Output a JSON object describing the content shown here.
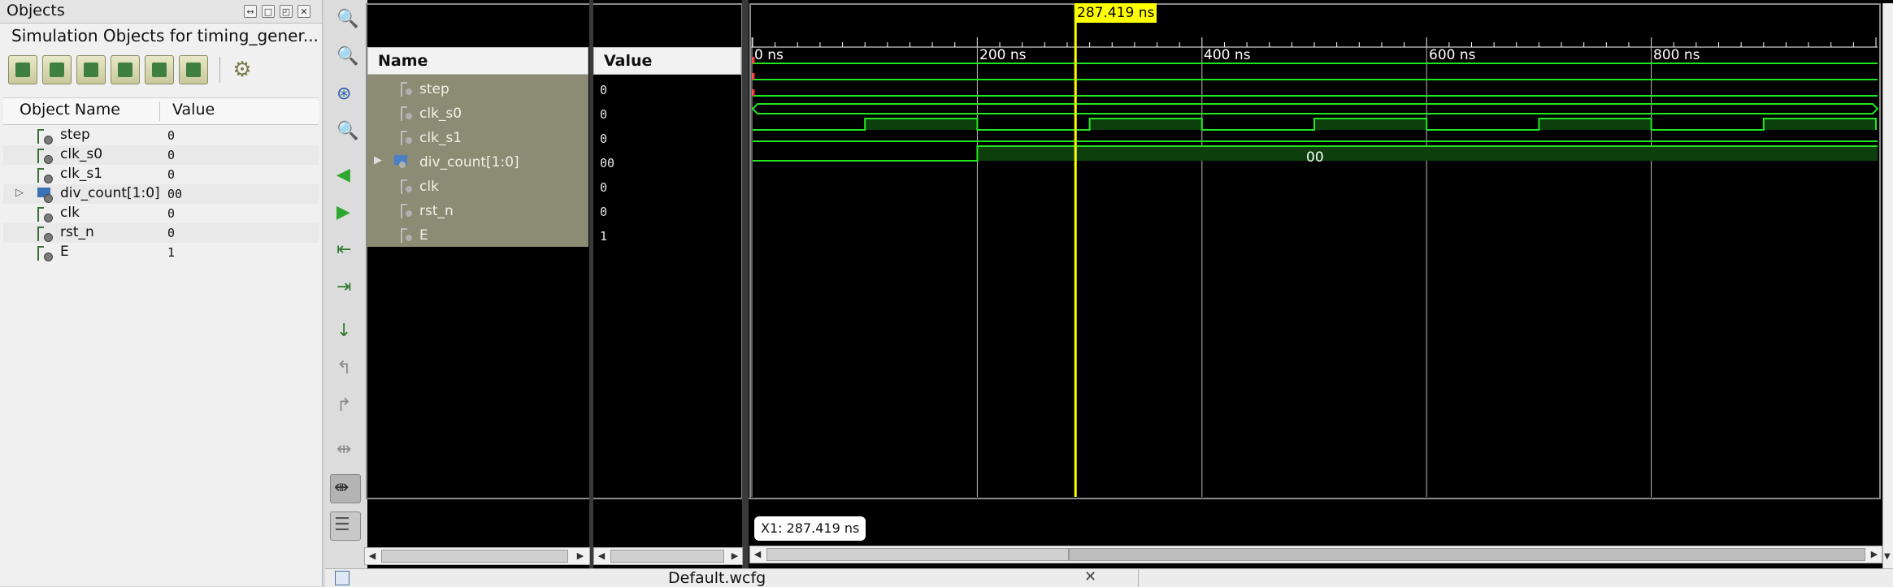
{
  "objects_panel": {
    "title": "Objects",
    "subtitle": "Simulation Objects for timing_gener...",
    "columns": {
      "name": "Object Name",
      "value": "Value"
    },
    "rows": [
      {
        "name": "step",
        "value": "0"
      },
      {
        "name": "clk_s0",
        "value": "0"
      },
      {
        "name": "clk_s1",
        "value": "0"
      },
      {
        "name": "div_count[1:0]",
        "value": "00"
      },
      {
        "name": "clk",
        "value": "0"
      },
      {
        "name": "rst_n",
        "value": "0"
      },
      {
        "name": "E",
        "value": "1"
      }
    ]
  },
  "wave": {
    "name_header": "Name",
    "value_header": "Value",
    "signals": [
      {
        "name": "step",
        "value": "0"
      },
      {
        "name": "clk_s0",
        "value": "0"
      },
      {
        "name": "clk_s1",
        "value": "0"
      },
      {
        "name": "div_count[1:0]",
        "value": "00"
      },
      {
        "name": "clk",
        "value": "0"
      },
      {
        "name": "rst_n",
        "value": "0"
      },
      {
        "name": "E",
        "value": "1"
      }
    ],
    "bus_value": "00",
    "time_ticks": [
      "0 ns",
      "200 ns",
      "400 ns",
      "600 ns",
      "800 ns"
    ],
    "cursor_label": "287.419 ns",
    "x1_readout": "X1: 287.419 ns",
    "wave_color": "#22e622",
    "cursor_color": "#ffff00"
  },
  "bottom_tab": {
    "label": "Default.wcfg"
  }
}
